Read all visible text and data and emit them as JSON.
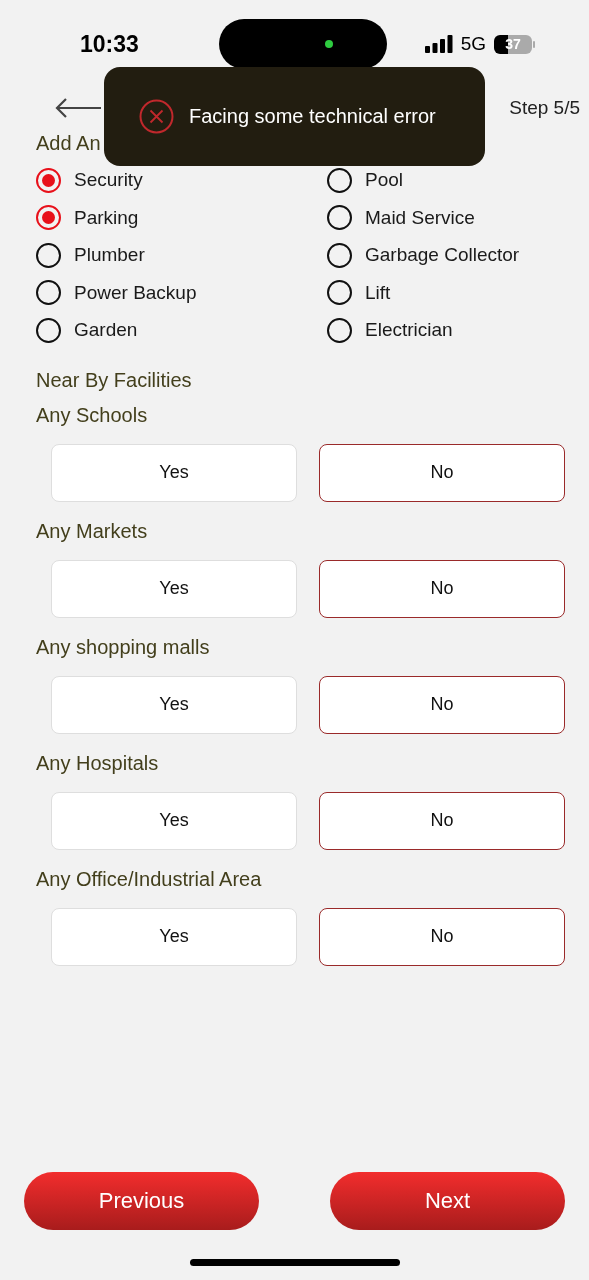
{
  "status_bar": {
    "time": "10:33",
    "network": "5G",
    "battery": "37"
  },
  "header": {
    "step": "Step 5/5"
  },
  "toast": {
    "message": "Facing some technical error"
  },
  "amenities": {
    "title": "Add An",
    "options": [
      {
        "label": "Security",
        "selected": true
      },
      {
        "label": "Pool",
        "selected": false
      },
      {
        "label": "Parking",
        "selected": true
      },
      {
        "label": "Maid Service",
        "selected": false
      },
      {
        "label": "Plumber",
        "selected": false
      },
      {
        "label": "Garbage Collector",
        "selected": false
      },
      {
        "label": "Power Backup",
        "selected": false
      },
      {
        "label": "Lift",
        "selected": false
      },
      {
        "label": "Garden",
        "selected": false
      },
      {
        "label": "Electrician",
        "selected": false
      }
    ]
  },
  "facilities": {
    "title": "Near By Facilities",
    "questions": [
      {
        "label": "Any Schools",
        "options": [
          {
            "label": "Yes",
            "selected": false
          },
          {
            "label": "No",
            "selected": true
          }
        ]
      },
      {
        "label": "Any Markets",
        "options": [
          {
            "label": "Yes",
            "selected": false
          },
          {
            "label": "No",
            "selected": true
          }
        ]
      },
      {
        "label": "Any shopping malls",
        "options": [
          {
            "label": "Yes",
            "selected": false
          },
          {
            "label": "No",
            "selected": true
          }
        ]
      },
      {
        "label": "Any Hospitals",
        "options": [
          {
            "label": "Yes",
            "selected": false
          },
          {
            "label": "No",
            "selected": true
          }
        ]
      },
      {
        "label": "Any Office/Industrial Area",
        "options": [
          {
            "label": "Yes",
            "selected": false
          },
          {
            "label": "No",
            "selected": true
          }
        ]
      }
    ]
  },
  "footer": {
    "buttons": [
      "Previous",
      "Next"
    ]
  }
}
